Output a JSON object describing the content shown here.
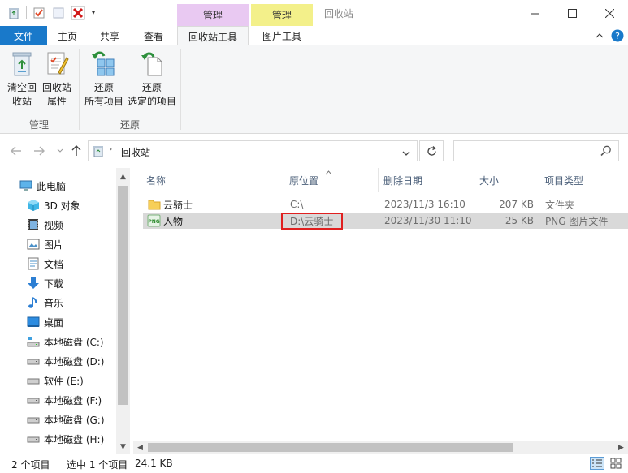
{
  "window": {
    "title": "回收站",
    "context_tabs": [
      "管理",
      "管理"
    ]
  },
  "ribbon_tabs": [
    {
      "label": "文件"
    },
    {
      "label": "主页"
    },
    {
      "label": "共享"
    },
    {
      "label": "查看"
    },
    {
      "label": "回收站工具"
    },
    {
      "label": "图片工具"
    }
  ],
  "ribbon": {
    "empty_bin": {
      "line1": "清空回",
      "line2": "收站"
    },
    "bin_props": {
      "line1": "回收站",
      "line2": "属性"
    },
    "restore_all": {
      "line1": "还原",
      "line2": "所有项目"
    },
    "restore_selected": {
      "line1": "还原",
      "line2": "选定的项目"
    },
    "group_manage": "管理",
    "group_restore": "还原"
  },
  "address": {
    "path": "回收站"
  },
  "tree": [
    {
      "label": "此电脑",
      "icon": "computer-icon"
    },
    {
      "label": "3D 对象",
      "icon": "3d-objects-icon"
    },
    {
      "label": "视频",
      "icon": "video-icon"
    },
    {
      "label": "图片",
      "icon": "pictures-icon"
    },
    {
      "label": "文档",
      "icon": "documents-icon"
    },
    {
      "label": "下载",
      "icon": "download-icon"
    },
    {
      "label": "音乐",
      "icon": "music-icon"
    },
    {
      "label": "桌面",
      "icon": "desktop-icon"
    },
    {
      "label": "本地磁盘 (C:)",
      "icon": "drive-c-icon"
    },
    {
      "label": "本地磁盘 (D:)",
      "icon": "drive-icon"
    },
    {
      "label": "软件 (E:)",
      "icon": "drive-icon"
    },
    {
      "label": "本地磁盘 (F:)",
      "icon": "drive-icon"
    },
    {
      "label": "本地磁盘 (G:)",
      "icon": "drive-icon"
    },
    {
      "label": "本地磁盘 (H:)",
      "icon": "drive-icon"
    }
  ],
  "columns": [
    "名称",
    "原位置",
    "删除日期",
    "大小",
    "项目类型"
  ],
  "files": [
    {
      "name": "云骑士",
      "location": "C:\\",
      "deleted": "2023/11/3 16:10",
      "size": "207 KB",
      "type": "文件夹",
      "icon": "folder-icon"
    },
    {
      "name": "人物",
      "location": "D:\\云骑士",
      "deleted": "2023/11/30 11:10",
      "size": "25 KB",
      "type": "PNG 图片文件",
      "icon": "png-file-icon"
    }
  ],
  "status": {
    "count": "2 个项目",
    "selected": "选中 1 个项目",
    "size": "24.1 KB"
  },
  "colors": {
    "accent": "#1979ca",
    "mgmt_pink": "#e9c9f2",
    "mgmt_yellow": "#f3f08a",
    "highlight": "#e02020"
  }
}
